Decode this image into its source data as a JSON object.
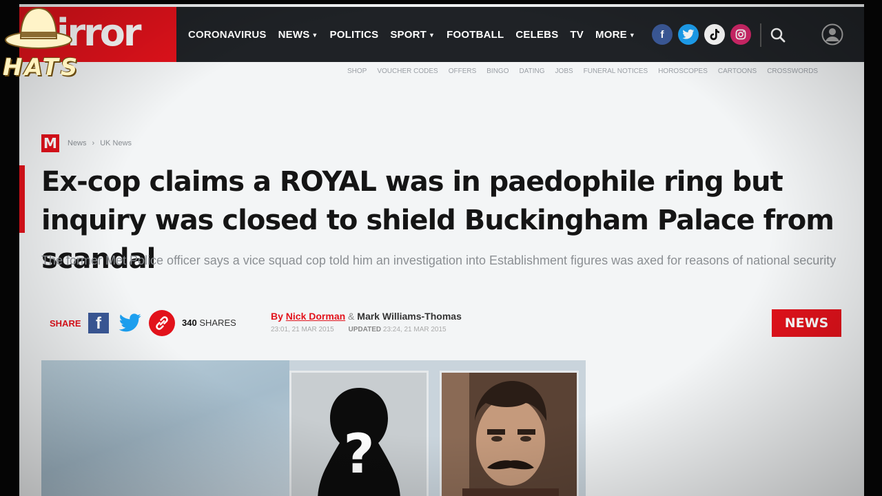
{
  "header": {
    "logo_text": "irror",
    "nav": [
      {
        "label": "CORONAVIRUS",
        "has_dropdown": false
      },
      {
        "label": "NEWS",
        "has_dropdown": true
      },
      {
        "label": "POLITICS",
        "has_dropdown": false
      },
      {
        "label": "SPORT",
        "has_dropdown": true
      },
      {
        "label": "FOOTBALL",
        "has_dropdown": false
      },
      {
        "label": "CELEBS",
        "has_dropdown": false
      },
      {
        "label": "TV",
        "has_dropdown": false
      },
      {
        "label": "MORE",
        "has_dropdown": true
      }
    ],
    "social_icons": [
      "facebook-icon",
      "twitter-icon",
      "tiktok-icon",
      "instagram-icon"
    ],
    "subnav": [
      "SHOP",
      "VOUCHER CODES",
      "OFFERS",
      "BINGO",
      "DATING",
      "JOBS",
      "FUNERAL NOTICES",
      "HOROSCOPES",
      "CARTOONS",
      "CROSSWORDS"
    ]
  },
  "article": {
    "breadcrumb": [
      "News",
      "UK News"
    ],
    "headline": "Ex-cop claims a ROYAL was in paedophile ring but inquiry was closed to shield Buckingham Palace from scandal",
    "standfirst": "The former Met Police officer says a vice squad cop told him an investigation into Establishment figures was axed for reasons of national security",
    "share_label": "SHARE",
    "share_count": "340",
    "share_suffix": "SHARES",
    "by_label": "By",
    "author_1": "Nick Dorman",
    "author_sep": "&",
    "author_2": "Mark Williams-Thomas",
    "published": "23:01, 21 MAR 2015",
    "updated_label": "UPDATED",
    "updated": "23:24, 21 MAR 2015",
    "section_badge": "NEWS"
  },
  "watermark": {
    "text": "HATS"
  },
  "colors": {
    "brand_red": "#e2121b",
    "header_bg": "#1f2226",
    "page_bg": "#f3f5f6"
  }
}
